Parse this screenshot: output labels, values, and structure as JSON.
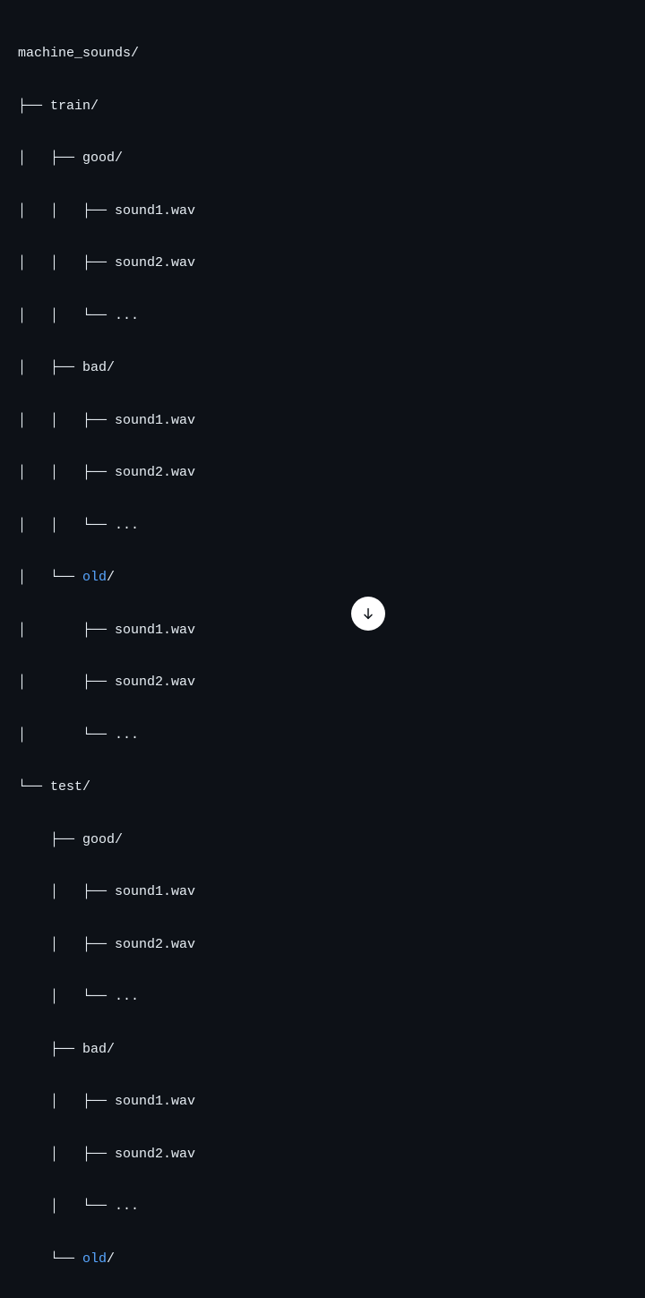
{
  "tree": {
    "l0": "machine_sounds/",
    "l1": "├── train/",
    "l2": "│   ├── good/",
    "l3": "│   │   ├── sound1.wav",
    "l4": "│   │   ├── sound2.wav",
    "l5": "│   │   └── ...",
    "l6": "│   ├── bad/",
    "l7": "│   │   ├── sound1.wav",
    "l8": "│   │   ├── sound2.wav",
    "l9": "│   │   └── ...",
    "l10p": "│   └── ",
    "l10h": "old",
    "l10s": "/",
    "l11": "│       ├── sound1.wav",
    "l12": "│       ├── sound2.wav",
    "l13": "│       └── ...",
    "l14": "└── test/",
    "l15": "    ├── good/",
    "l16": "    │   ├── sound1.wav",
    "l17": "    │   ├── sound2.wav",
    "l18": "    │   └── ...",
    "l19": "    ├── bad/",
    "l20": "    │   ├── sound1.wav",
    "l21": "    │   ├── sound2.wav",
    "l22": "    │   └── ...",
    "l23p": "    └── ",
    "l23h": "old",
    "l23s": "/"
  }
}
